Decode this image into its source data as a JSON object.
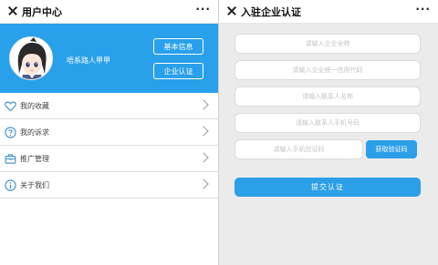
{
  "left_panel": {
    "nav": {
      "title": "用户中心",
      "more": "···"
    },
    "profile": {
      "username": "唔系路人甲甲",
      "buttons": [
        "基本信息",
        "企业认证"
      ]
    },
    "menu": [
      {
        "label": "我的收藏",
        "icon": "heart-icon"
      },
      {
        "label": "我的诉求",
        "icon": "question-icon"
      },
      {
        "label": "推广管理",
        "icon": "briefcase-icon"
      },
      {
        "label": "关于我们",
        "icon": "info-icon"
      }
    ]
  },
  "right_panel": {
    "nav": {
      "title": "入驻企业认证",
      "more": "···"
    },
    "fields": {
      "company_name": "请输入企业全称",
      "credit_code": "请输入企业统一信用代码",
      "contact_name": "请输入联系人名称",
      "contact_phone": "请输入联系人手机号码",
      "sms_code": "请输入手机验证码"
    },
    "get_code_label": "获取验证码",
    "submit_label": "提交认证"
  },
  "colors": {
    "accent": "#29a0ea",
    "button": "#2b9fe8"
  }
}
